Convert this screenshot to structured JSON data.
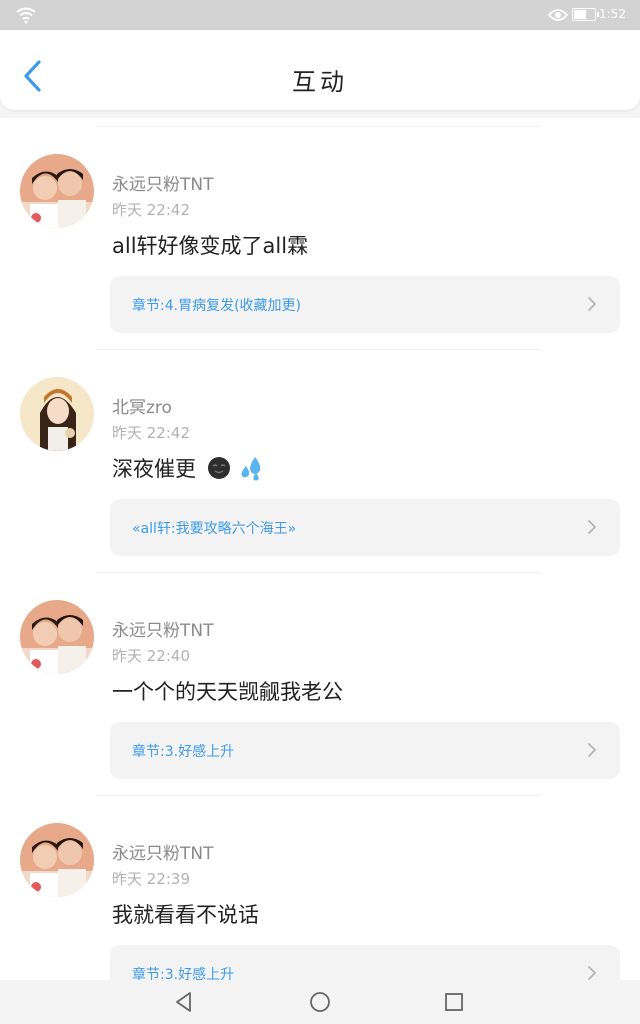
{
  "status_bar": {
    "time": "1:52",
    "icons": [
      "wifi-icon",
      "eye-icon",
      "battery-icon"
    ]
  },
  "header": {
    "title": "互动",
    "back_icon": "chevron-left-icon"
  },
  "colors": {
    "accent": "#3d9be9",
    "name_text": "#8a8a8a",
    "time_text": "#b2b2b2",
    "chapter_bg": "#f3f3f3"
  },
  "comments": [
    {
      "name": "永远只粉TNT",
      "time": "昨天 22:42",
      "content": "all轩好像变成了all霖",
      "chapter": "章节:4.胃病复发(收藏加更)"
    },
    {
      "name": "北冥zro",
      "time": "昨天 22:42",
      "content": "深夜催更",
      "emojis": [
        "dark-face-emoji",
        "sweat-drops-emoji"
      ],
      "chapter": "«all轩:我要攻略六个海王»"
    },
    {
      "name": "永远只粉TNT",
      "time": "昨天 22:40",
      "content": "一个个的天天觊觎我老公",
      "chapter": "章节:3.好感上升"
    },
    {
      "name": "永远只粉TNT",
      "time": "昨天 22:39",
      "content": "我就看看不说话",
      "chapter": "章节:3.好感上升"
    }
  ],
  "nav_bar": {
    "buttons": [
      "back-triangle-icon",
      "home-circle-icon",
      "recents-square-icon"
    ]
  }
}
